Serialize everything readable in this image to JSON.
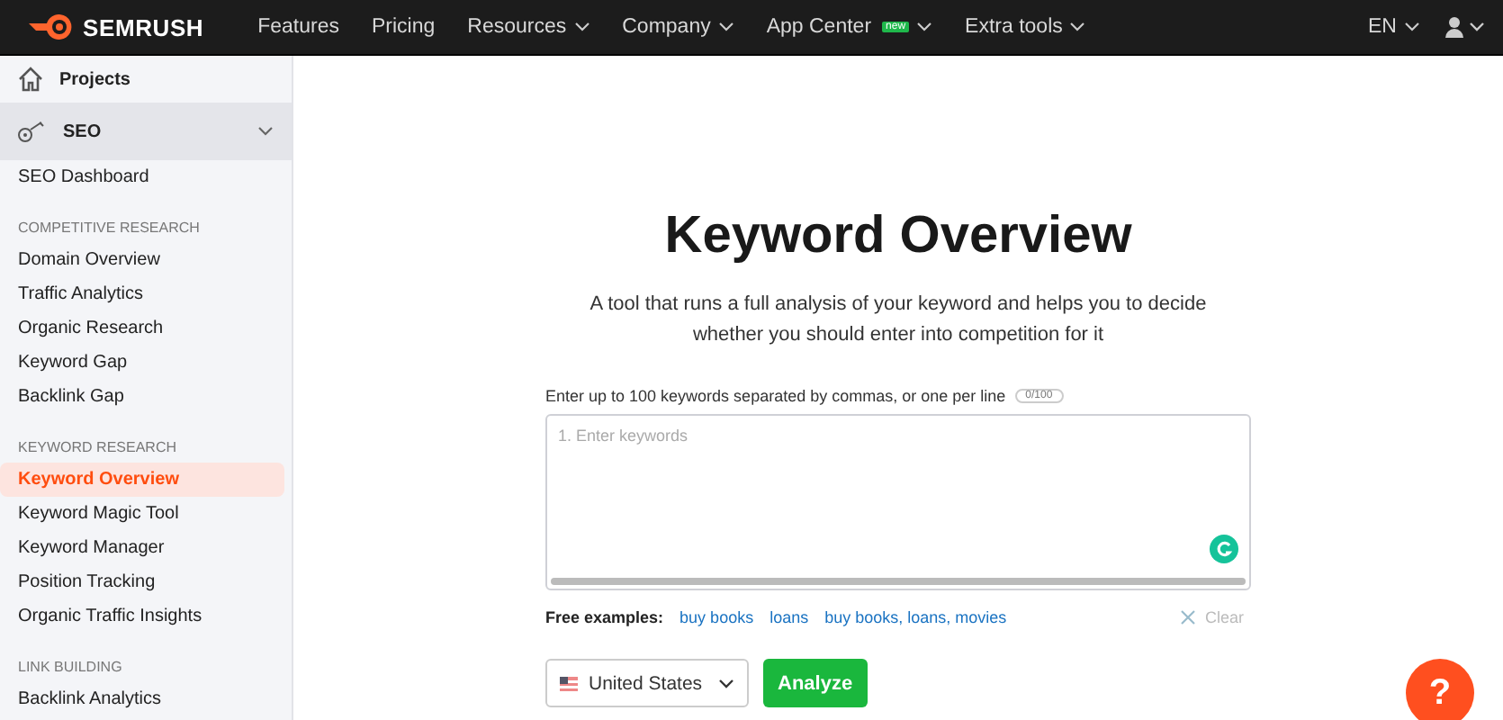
{
  "topbar": {
    "logo": "SEMRUSH",
    "nav": [
      {
        "label": "Features",
        "dropdown": false
      },
      {
        "label": "Pricing",
        "dropdown": false
      },
      {
        "label": "Resources",
        "dropdown": true
      },
      {
        "label": "Company",
        "dropdown": true
      },
      {
        "label": "App Center",
        "dropdown": true,
        "badge": "new"
      },
      {
        "label": "Extra tools",
        "dropdown": true
      }
    ],
    "language": "EN"
  },
  "sidebar": {
    "projects": "Projects",
    "seo": {
      "label": "SEO",
      "expanded": true
    },
    "items": [
      {
        "kind": "item",
        "label": "SEO Dashboard",
        "selected": false
      },
      {
        "kind": "header",
        "label": "COMPETITIVE RESEARCH"
      },
      {
        "kind": "item",
        "label": "Domain Overview",
        "selected": false
      },
      {
        "kind": "item",
        "label": "Traffic Analytics",
        "selected": false
      },
      {
        "kind": "item",
        "label": "Organic Research",
        "selected": false
      },
      {
        "kind": "item",
        "label": "Keyword Gap",
        "selected": false
      },
      {
        "kind": "item",
        "label": "Backlink Gap",
        "selected": false
      },
      {
        "kind": "header",
        "label": "KEYWORD RESEARCH"
      },
      {
        "kind": "item",
        "label": "Keyword Overview",
        "selected": true
      },
      {
        "kind": "item",
        "label": "Keyword Magic Tool",
        "selected": false
      },
      {
        "kind": "item",
        "label": "Keyword Manager",
        "selected": false
      },
      {
        "kind": "item",
        "label": "Position Tracking",
        "selected": false
      },
      {
        "kind": "item",
        "label": "Organic Traffic Insights",
        "selected": false
      },
      {
        "kind": "header",
        "label": "LINK BUILDING"
      },
      {
        "kind": "item",
        "label": "Backlink Analytics",
        "selected": false
      }
    ]
  },
  "main": {
    "title": "Keyword Overview",
    "subtitle": "A tool that runs a full analysis of your keyword and helps you to decide whether you should enter into competition for it",
    "input_label": "Enter up to 100 keywords separated by commas, or one per line",
    "counter": "0/100",
    "line_number": "1.",
    "placeholder": "Enter keywords",
    "examples_label": "Free examples:",
    "examples": [
      "buy books",
      "loans",
      "buy books, loans, movies"
    ],
    "clear": "Clear",
    "country": "United States",
    "analyze": "Analyze",
    "help": "?"
  }
}
